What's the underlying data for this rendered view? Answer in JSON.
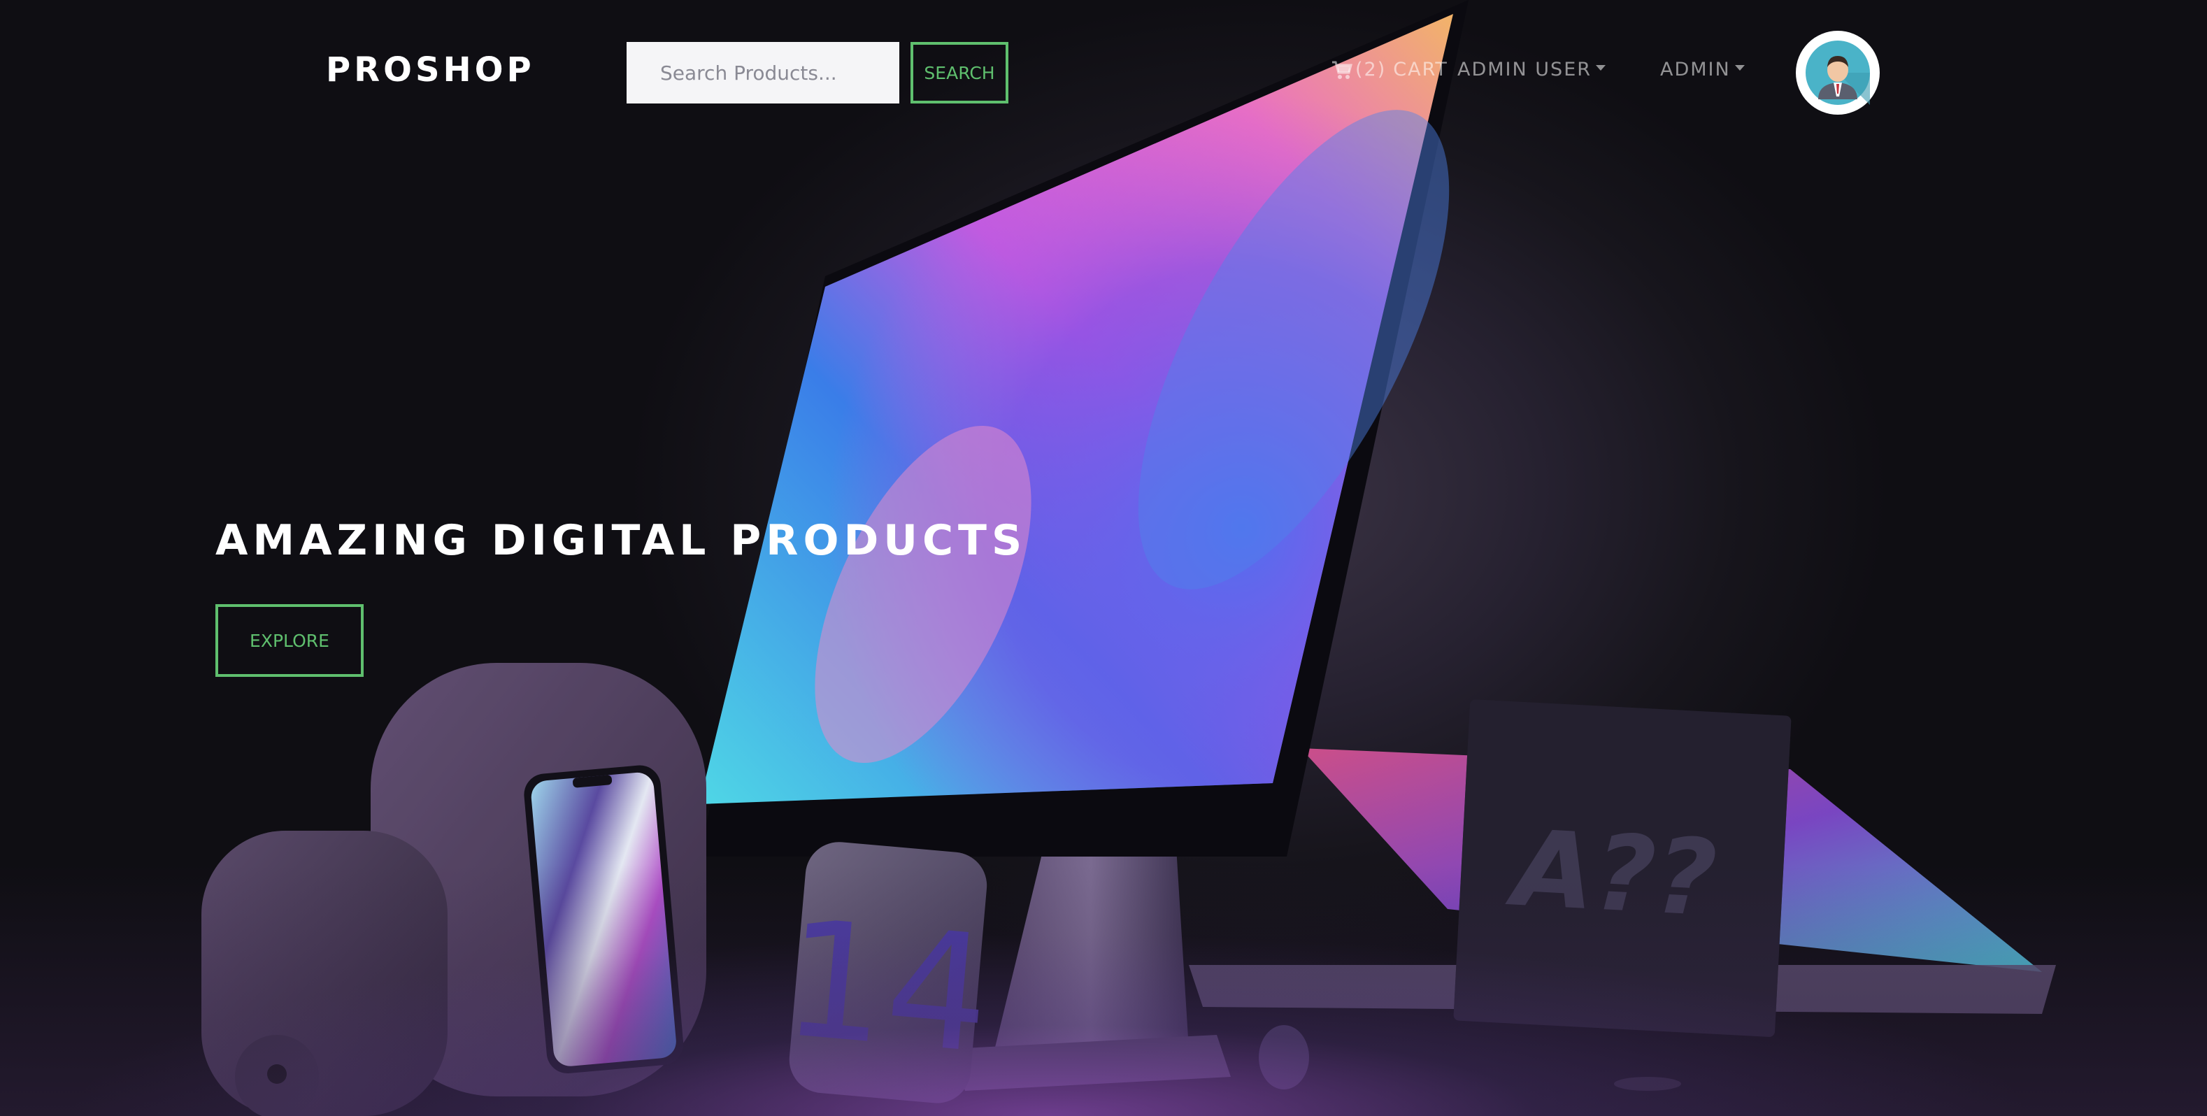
{
  "navbar": {
    "brand": "PROSHOP",
    "search": {
      "placeholder": "Search Products...",
      "value": ""
    },
    "search_button_label": "SEARCH",
    "cart": {
      "count_label": "(2)",
      "label": "CART",
      "icon": "cart-icon"
    },
    "user_menu_label": "ADMIN USER",
    "admin_menu_label": "ADMIN",
    "avatar_icon": "user-avatar-icon"
  },
  "hero": {
    "title": "AMAZING DIGITAL PRODUCTS",
    "explore_button_label": "EXPLORE",
    "chip_label": "A??",
    "badge_number": "14"
  },
  "colors": {
    "accent": "#5fbf6e",
    "brand_text": "#ffffff",
    "background": "#15131a",
    "avatar_ring": "#ffffff",
    "avatar_bg": "#4ab3c8"
  }
}
